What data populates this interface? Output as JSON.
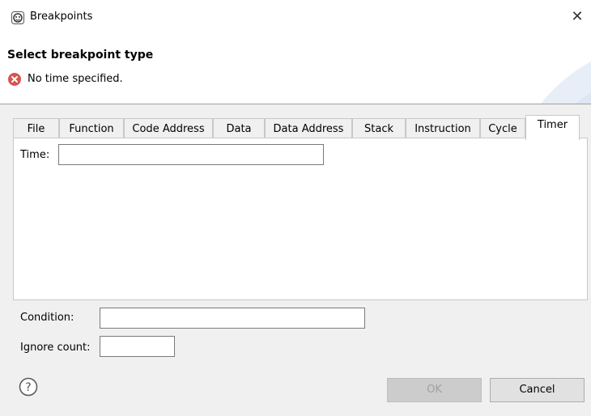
{
  "window": {
    "title": "Breakpoints",
    "app_icon": "breakpoint-dialog-icon",
    "close_icon": "close-icon",
    "close_glyph": "✕"
  },
  "banner": {
    "title": "Select breakpoint type",
    "message": "No time specified.",
    "message_icon": "error-icon"
  },
  "tabs": [
    {
      "label": "File"
    },
    {
      "label": "Function"
    },
    {
      "label": "Code Address"
    },
    {
      "label": "Data"
    },
    {
      "label": "Data Address"
    },
    {
      "label": "Stack"
    },
    {
      "label": "Instruction"
    },
    {
      "label": "Cycle"
    },
    {
      "label": "Timer",
      "active": true
    }
  ],
  "timer": {
    "time_label": "Time:",
    "time_value": ""
  },
  "condition": {
    "label": "Condition:",
    "value": ""
  },
  "ignore_count": {
    "label": "Ignore count:",
    "value": ""
  },
  "buttons": {
    "help_icon": "help-icon",
    "ok": "OK",
    "cancel": "Cancel"
  },
  "colors": {
    "error_red": "#d9534f",
    "ok_disabled_bg": "#cccccc",
    "cancel_bg": "#e1e1e1"
  }
}
